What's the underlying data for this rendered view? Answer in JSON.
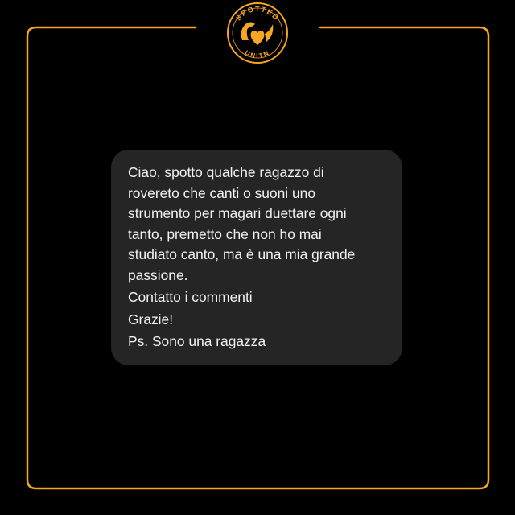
{
  "brand": {
    "logo_text_top": "SPOTTED",
    "logo_text_bottom": "UNITN",
    "logo_icon": "eagle-heart-logo-icon",
    "accent_color": "#f5a623"
  },
  "message": {
    "paragraphs": [
      "Ciao, spotto qualche ragazzo di\nrovereto che canti o suoni uno\nstrumento per magari duettare ogni\ntanto, premetto che non ho mai\nstudiato canto, ma è una mia grande\npassione.",
      "Contatto i commenti",
      "Grazie!",
      "Ps. Sono una ragazza"
    ]
  },
  "colors": {
    "background": "#000000",
    "bubble": "#252525",
    "text": "#f2f2f2",
    "frame": "#f5a623"
  }
}
